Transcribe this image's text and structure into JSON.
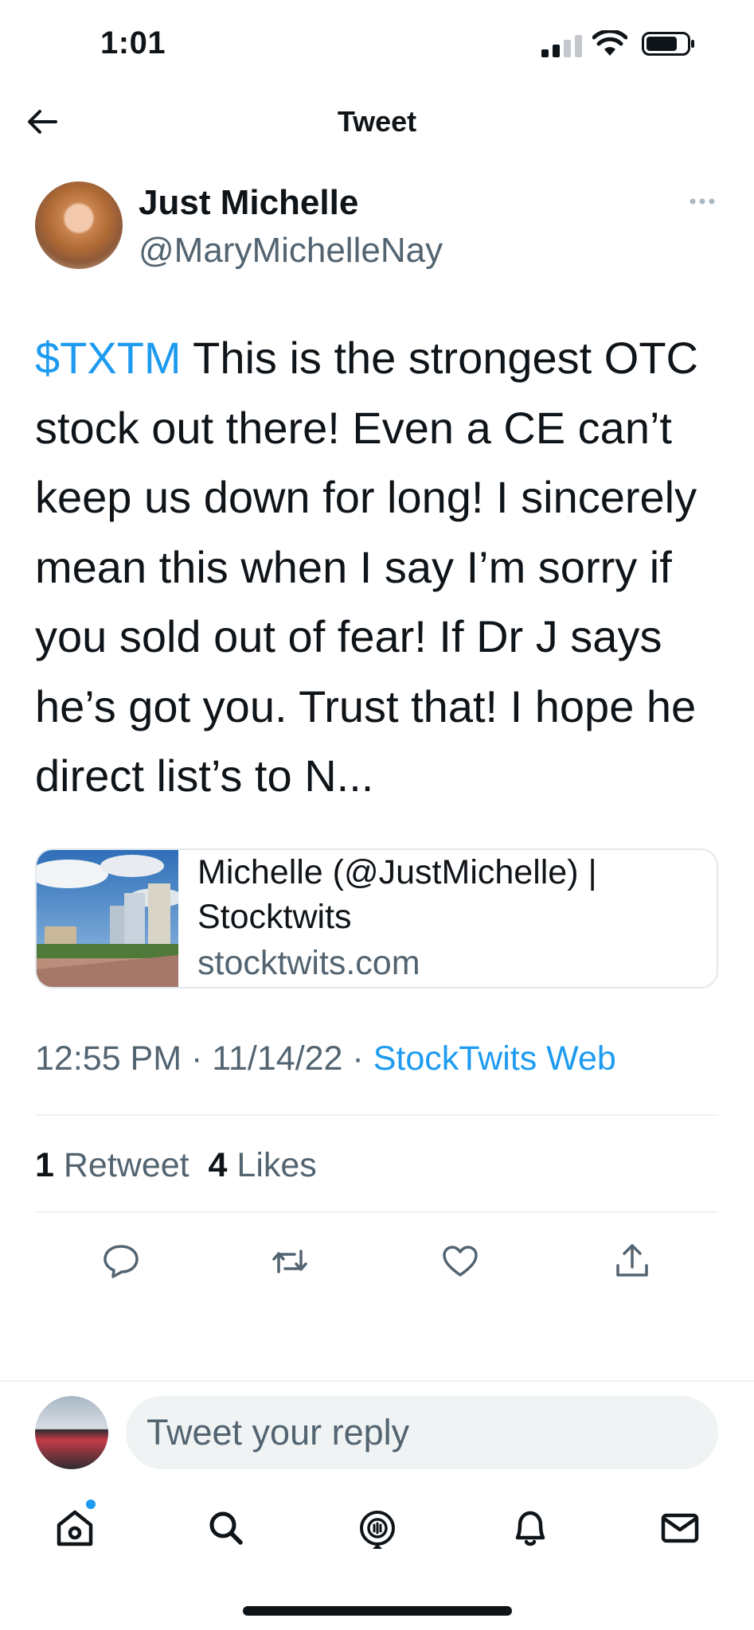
{
  "status_bar": {
    "time": "1:01"
  },
  "header": {
    "title": "Tweet"
  },
  "author": {
    "display_name": "Just Michelle",
    "handle": "@MaryMichelleNay"
  },
  "tweet": {
    "cashtag": "$TXTM",
    "text": " This is the strongest OTC stock out there! Even a CE can’t keep us down for long! I sincerely mean this when I say I’m sorry if you sold out of fear! If Dr J says he’s got you. Trust that! I hope he direct list’s to N..."
  },
  "link_card": {
    "title": "Michelle (@JustMichelle) | Stocktwits",
    "domain": "stocktwits.com"
  },
  "meta": {
    "time": "12:55 PM",
    "separator1": " · ",
    "date": "11/14/22",
    "separator2": " · ",
    "source": "StockTwits Web"
  },
  "stats": {
    "retweets_count": "1",
    "retweets_label": "Retweet",
    "likes_count": "4",
    "likes_label": "Likes"
  },
  "reply": {
    "placeholder": "Tweet your reply"
  },
  "icons": {
    "back": "arrow-left-icon",
    "more": "more-horizontal-icon",
    "reply": "comment-icon",
    "retweet": "retweet-icon",
    "like": "heart-icon",
    "share": "share-icon",
    "tabs": [
      "home-icon",
      "search-icon",
      "spaces-icon",
      "bell-icon",
      "mail-icon"
    ]
  },
  "colors": {
    "accent": "#1d9bf0",
    "text": "#0f1419",
    "secondary": "#536471",
    "divider": "#eff3f4"
  }
}
